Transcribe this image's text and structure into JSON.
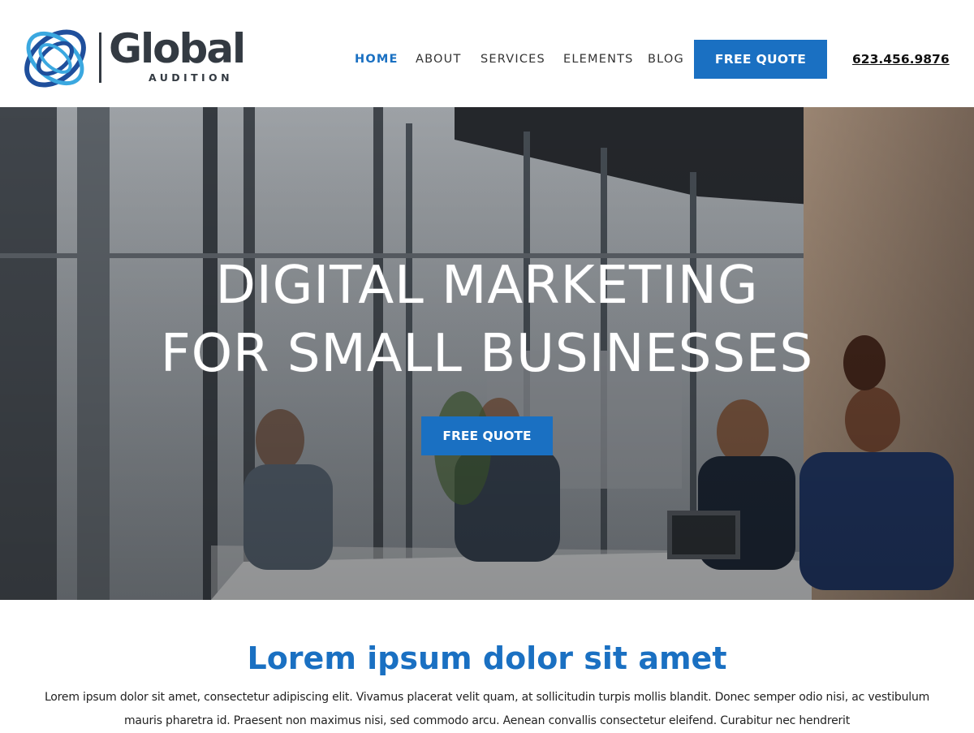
{
  "header": {
    "logo": {
      "word": "Global",
      "sub": "AUDITION"
    },
    "nav": {
      "items": [
        {
          "label": "HOME",
          "active": true
        },
        {
          "label": "ABOUT",
          "active": false
        },
        {
          "label": "SERVICES",
          "active": false
        },
        {
          "label": "ELEMENTS",
          "active": false
        },
        {
          "label": "BLOG",
          "active": false
        }
      ]
    },
    "cta_label": "FREE QUOTE",
    "phone": "623.456.9876"
  },
  "hero": {
    "title_line1": "DIGITAL MARKETING",
    "title_line2": "FOR SMALL BUSINESSES",
    "cta_label": "FREE QUOTE"
  },
  "intro": {
    "heading": "Lorem ipsum dolor sit amet",
    "body": "Lorem ipsum dolor sit amet, consectetur adipiscing elit. Vivamus placerat velit quam, at sollicitudin turpis mollis blandit. Donec semper odio nisi, ac vestibulum mauris pharetra id. Praesent non maximus nisi, sed commodo arcu. Aenean convallis consectetur eleifend. Curabitur nec hendrerit"
  },
  "colors": {
    "accent": "#1a70c2",
    "logo_dark": "#333a42",
    "logo_light_blue": "#3ba8e0",
    "logo_dark_blue": "#1f4f9c"
  },
  "icons": {
    "logo_mark": "interlocking-rings-logo-icon",
    "hero_photo": "office-meeting-photo"
  }
}
